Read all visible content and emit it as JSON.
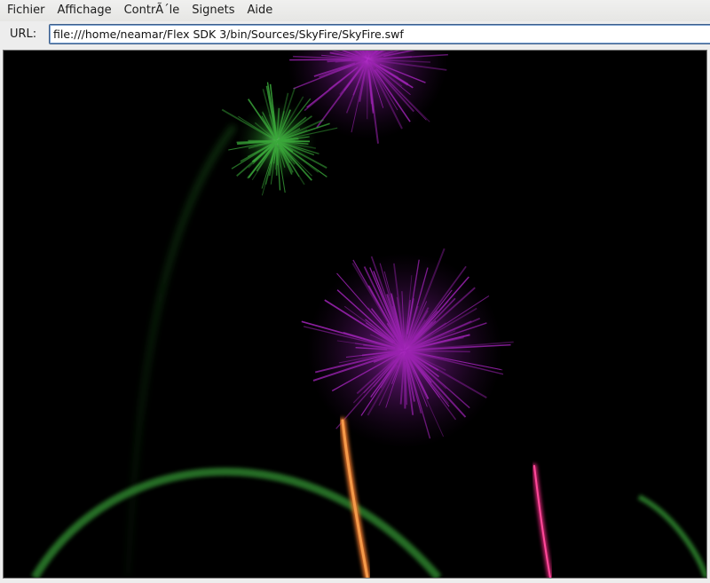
{
  "menubar": {
    "items": [
      {
        "name": "menu-fichier",
        "label": "Fichier"
      },
      {
        "name": "menu-affichage",
        "label": "Affichage"
      },
      {
        "name": "menu-controle",
        "label": "ContrÃ´le"
      },
      {
        "name": "menu-signets",
        "label": "Signets"
      },
      {
        "name": "menu-aide",
        "label": "Aide"
      }
    ]
  },
  "urlbar": {
    "label": "URL:",
    "value": "file:///home/neamar/Flex SDK 3/bin/Sources/SkyFire/SkyFire.swf"
  },
  "stage": {
    "background": "#000000",
    "colors": {
      "green": "#3aa83a",
      "purple": "#9a22b0",
      "orange": "#e8762a",
      "magenta": "#e0257a"
    }
  }
}
